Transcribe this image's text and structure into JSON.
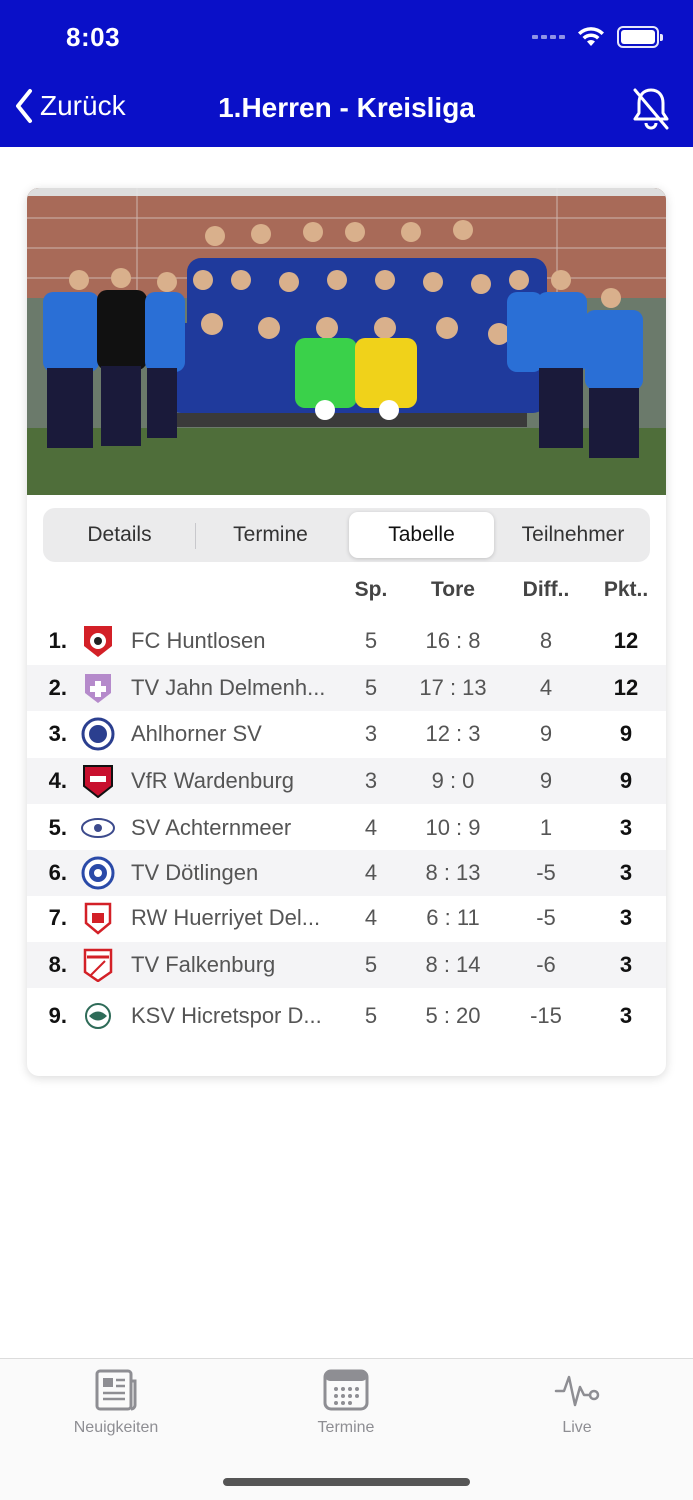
{
  "status": {
    "time": "8:03",
    "icons": [
      "signal-icon",
      "wifi-icon",
      "battery-icon"
    ]
  },
  "nav": {
    "back_label": "Zurück",
    "title": "1.Herren - Kreisliga",
    "bell_icon": "bell-slash-icon",
    "bar_color": "#0a10c8"
  },
  "segments": [
    {
      "label": "Details",
      "active": false
    },
    {
      "label": "Termine",
      "active": false
    },
    {
      "label": "Tabelle",
      "active": true
    },
    {
      "label": "Teilnehmer",
      "active": false
    }
  ],
  "table": {
    "headers": {
      "sp": "Sp.",
      "tore": "Tore",
      "diff": "Diff..",
      "pkt": "Pkt.."
    },
    "rows": [
      {
        "rank": "1.",
        "name": "FC Huntlosen",
        "sp": "5",
        "tore": "16 : 8",
        "diff": "8",
        "pkt": "12"
      },
      {
        "rank": "2.",
        "name": "TV Jahn Delmenh...",
        "sp": "5",
        "tore": "17 : 13",
        "diff": "4",
        "pkt": "12"
      },
      {
        "rank": "3.",
        "name": "Ahlhorner SV",
        "sp": "3",
        "tore": "12 : 3",
        "diff": "9",
        "pkt": "9"
      },
      {
        "rank": "4.",
        "name": "VfR Wardenburg",
        "sp": "3",
        "tore": "9 : 0",
        "diff": "9",
        "pkt": "9"
      },
      {
        "rank": "5.",
        "name": "SV Achternmeer",
        "sp": "4",
        "tore": "10 : 9",
        "diff": "1",
        "pkt": "3"
      },
      {
        "rank": "6.",
        "name": "TV Dötlingen",
        "sp": "4",
        "tore": "8 : 13",
        "diff": "-5",
        "pkt": "3"
      },
      {
        "rank": "7.",
        "name": "RW Huerriyet Del...",
        "sp": "4",
        "tore": "6 : 11",
        "diff": "-5",
        "pkt": "3"
      },
      {
        "rank": "8.",
        "name": "TV Falkenburg",
        "sp": "5",
        "tore": "8 : 14",
        "diff": "-6",
        "pkt": "3"
      },
      {
        "rank": "9.",
        "name": "KSV Hicretspor D...",
        "sp": "5",
        "tore": "5 : 20",
        "diff": "-15",
        "pkt": "3"
      }
    ]
  },
  "tabbar": [
    {
      "label": "Neuigkeiten",
      "icon": "newspaper-icon"
    },
    {
      "label": "Termine",
      "icon": "calendar-icon"
    },
    {
      "label": "Live",
      "icon": "pulse-icon"
    }
  ]
}
